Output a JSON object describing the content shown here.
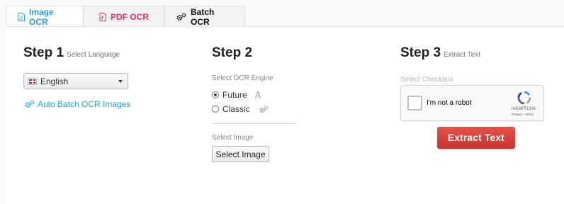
{
  "tabs": [
    {
      "label": "Image OCR",
      "icon": "document-icon",
      "active": true,
      "color": "#2ca0d8"
    },
    {
      "label": "PDF OCR",
      "icon": "pdf-file-icon",
      "color": "#e8306a"
    },
    {
      "label": "Batch OCR",
      "icon": "gears-icon",
      "color": "#111111"
    }
  ],
  "step1": {
    "title": "Step 1",
    "subtitle": "Select Language",
    "language": "English",
    "auto_batch_link": "Auto Batch OCR Images"
  },
  "step2": {
    "title": "Step 2",
    "engine_label": "Select OCR Engine",
    "engines": [
      {
        "label": "Future",
        "selected": true,
        "icon": "font-a-icon"
      },
      {
        "label": "Classic",
        "selected": false,
        "icon": "gears-icon"
      }
    ],
    "image_label": "Select Image",
    "select_image_button": "Select Image"
  },
  "step3": {
    "title": "Step 3",
    "subtitle": "Extract Text",
    "checkbox_label": "Select Checkbox",
    "captcha_text": "I'm not a robot",
    "captcha_brand": "reCAPTCHA",
    "captcha_terms": "Privacy - Terms",
    "extract_button": "Extract Text"
  },
  "colors": {
    "accent": "#2ca0d8",
    "pdf": "#e8306a",
    "extract": "#d43f3a"
  }
}
